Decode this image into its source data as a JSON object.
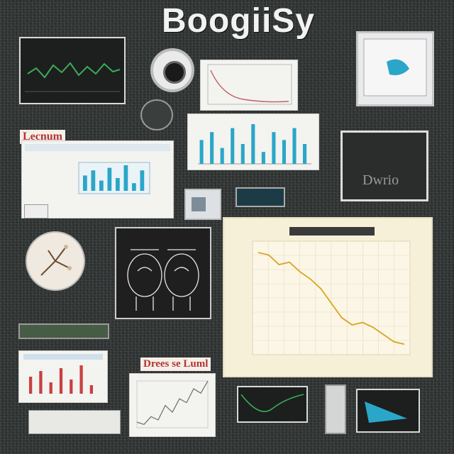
{
  "title": "BoogiiSy",
  "tags": {
    "top_left": "Lecnum",
    "bottom_middle": "Drees se Luml"
  },
  "panels": {
    "dark_right_text": "Dwrio"
  },
  "colors": {
    "background": "#2c302f",
    "accent_teal": "#2aa6c9",
    "line_green": "#3cab5a",
    "line_gold": "#d9a521",
    "bar_red": "#c94040",
    "cream": "#f7f0d8"
  },
  "chart_data": [
    {
      "type": "line",
      "title": "",
      "x": [
        0,
        1,
        2,
        3,
        4,
        5,
        6,
        7,
        8,
        9,
        10,
        11,
        12,
        13,
        14
      ],
      "series": [
        {
          "values": [
            80,
            78,
            70,
            72,
            64,
            58,
            50,
            38,
            26,
            20,
            22,
            18,
            12,
            6,
            4
          ]
        }
      ]
    },
    {
      "type": "bar",
      "series": [
        {
          "values": [
            6,
            8,
            4,
            9,
            5,
            10,
            3,
            8,
            6,
            9,
            5
          ]
        }
      ]
    },
    {
      "type": "line",
      "series": [
        {
          "values": [
            10,
            6,
            20,
            14,
            40,
            28,
            52,
            45,
            70,
            62,
            84
          ]
        }
      ]
    }
  ]
}
